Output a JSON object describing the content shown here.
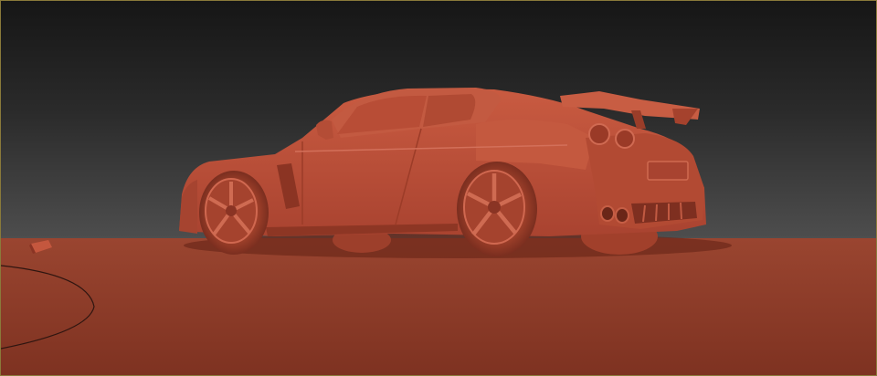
{
  "viewport": {
    "active": true,
    "background_top": "#161616",
    "background_bottom": "#555555",
    "border_color": "#8a7a3a"
  },
  "scene": {
    "ground_color": "#8e3c28",
    "model_color": "#c0543c",
    "model_shadow": "#7a2e1f",
    "model_highlight": "#d8715a"
  }
}
